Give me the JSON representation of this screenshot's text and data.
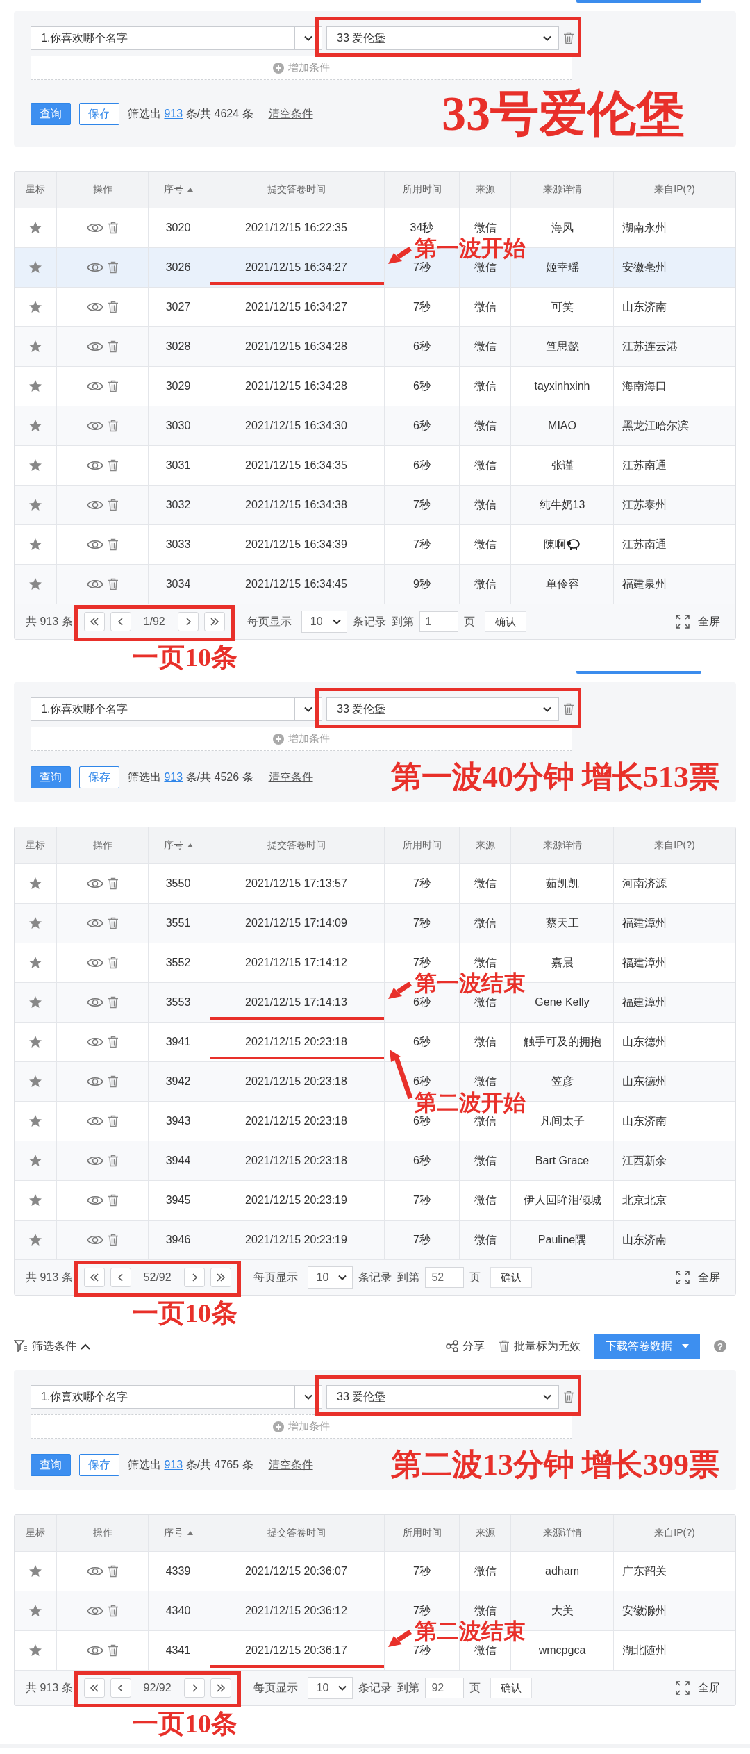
{
  "sections": [
    {
      "button_edge": true,
      "filter": {
        "field": "1.你喜欢哪个名字",
        "value": "33 爱伦堡",
        "value_frame": true,
        "add_label": "增加条件",
        "query": "查询",
        "save": "保存",
        "summary_prefix": "筛选出",
        "count": "913",
        "summary_suffix": "条/共 4624 条",
        "clear": "清空条件",
        "headline": "33号爱伦堡"
      },
      "columns": [
        "星标",
        "操作",
        "序号",
        "提交答卷时间",
        "所用时间",
        "来源",
        "来源详情",
        "来自IP(?)"
      ],
      "rows": [
        {
          "seq": "3020",
          "time": "2021/12/15 16:22:35",
          "duration": "34秒",
          "source": "微信",
          "detail": "海风",
          "detail_icon": false,
          "ip": "湖南永州",
          "selected": false
        },
        {
          "seq": "3026",
          "time": "2021/12/15 16:34:27",
          "duration": "7秒",
          "source": "微信",
          "detail": "姬幸瑶",
          "detail_icon": false,
          "ip": "安徽亳州",
          "selected": true,
          "annotation": {
            "label": "第一波开始",
            "kind": "from-above"
          }
        },
        {
          "seq": "3027",
          "time": "2021/12/15 16:34:27",
          "duration": "7秒",
          "source": "微信",
          "detail": "可笑",
          "detail_icon": false,
          "ip": "山东济南",
          "selected": false
        },
        {
          "seq": "3028",
          "time": "2021/12/15 16:34:28",
          "duration": "6秒",
          "source": "微信",
          "detail": "笪思懿",
          "detail_icon": false,
          "ip": "江苏连云港",
          "selected": false
        },
        {
          "seq": "3029",
          "time": "2021/12/15 16:34:28",
          "duration": "6秒",
          "source": "微信",
          "detail": "tayxinhxinh",
          "detail_icon": false,
          "ip": "海南海口",
          "selected": false
        },
        {
          "seq": "3030",
          "time": "2021/12/15 16:34:30",
          "duration": "6秒",
          "source": "微信",
          "detail": "MIAO",
          "detail_icon": false,
          "ip": "黑龙江哈尔滨",
          "selected": false
        },
        {
          "seq": "3031",
          "time": "2021/12/15 16:34:35",
          "duration": "6秒",
          "source": "微信",
          "detail": "张谨",
          "detail_icon": false,
          "ip": "江苏南通",
          "selected": false
        },
        {
          "seq": "3032",
          "time": "2021/12/15 16:34:38",
          "duration": "7秒",
          "source": "微信",
          "detail": "纯牛奶13",
          "detail_icon": false,
          "ip": "江苏泰州",
          "selected": false
        },
        {
          "seq": "3033",
          "time": "2021/12/15 16:34:39",
          "duration": "7秒",
          "source": "微信",
          "detail": "陳啊",
          "detail_icon": true,
          "ip": "江苏南通",
          "selected": false
        },
        {
          "seq": "3034",
          "time": "2021/12/15 16:34:45",
          "duration": "9秒",
          "source": "微信",
          "detail": "单伶容",
          "detail_icon": false,
          "ip": "福建泉州",
          "selected": false
        }
      ],
      "pagination": {
        "total": "共 913 条",
        "page": "1/92",
        "per_page_label": "每页显示",
        "per_page": "10",
        "records_label": "条记录",
        "goto_label": "到第",
        "goto_value": "1",
        "page_label": "页",
        "confirm": "确认",
        "fullscreen": "全屏",
        "pager_frame": true
      },
      "page_note": "一页10条"
    },
    {
      "button_edge": true,
      "filter": {
        "field": "1.你喜欢哪个名字",
        "value": "33 爱伦堡",
        "value_frame": true,
        "add_label": "增加条件",
        "query": "查询",
        "save": "保存",
        "summary_prefix": "筛选出",
        "count": "913",
        "summary_suffix": "条/共 4526 条",
        "clear": "清空条件",
        "headline": "第一波40分钟 增长513票"
      },
      "columns": [
        "星标",
        "操作",
        "序号",
        "提交答卷时间",
        "所用时间",
        "来源",
        "来源详情",
        "来自IP(?)"
      ],
      "rows": [
        {
          "seq": "3550",
          "time": "2021/12/15 17:13:57",
          "duration": "7秒",
          "source": "微信",
          "detail": "茹凯凯",
          "detail_icon": false,
          "ip": "河南济源",
          "selected": false
        },
        {
          "seq": "3551",
          "time": "2021/12/15 17:14:09",
          "duration": "7秒",
          "source": "微信",
          "detail": "蔡天工",
          "detail_icon": false,
          "ip": "福建漳州",
          "selected": false
        },
        {
          "seq": "3552",
          "time": "2021/12/15 17:14:12",
          "duration": "7秒",
          "source": "微信",
          "detail": "嘉晨",
          "detail_icon": false,
          "ip": "福建漳州",
          "selected": false
        },
        {
          "seq": "3553",
          "time": "2021/12/15 17:14:13",
          "duration": "6秒",
          "source": "微信",
          "detail": "Gene Kelly",
          "detail_icon": false,
          "ip": "福建漳州",
          "selected": false,
          "annotation": {
            "label": "第一波结束",
            "kind": "from-above"
          }
        },
        {
          "seq": "3941",
          "time": "2021/12/15 20:23:18",
          "duration": "6秒",
          "source": "微信",
          "detail": "触手可及的拥抱",
          "detail_icon": false,
          "ip": "山东德州",
          "selected": false,
          "annotation": {
            "label": "第二波开始",
            "kind": "from-below"
          }
        },
        {
          "seq": "3942",
          "time": "2021/12/15 20:23:18",
          "duration": "6秒",
          "source": "微信",
          "detail": "笠彦",
          "detail_icon": false,
          "ip": "山东德州",
          "selected": false
        },
        {
          "seq": "3943",
          "time": "2021/12/15 20:23:18",
          "duration": "6秒",
          "source": "微信",
          "detail": "凡间太子",
          "detail_icon": false,
          "ip": "山东济南",
          "selected": false
        },
        {
          "seq": "3944",
          "time": "2021/12/15 20:23:18",
          "duration": "6秒",
          "source": "微信",
          "detail": "Bart Grace",
          "detail_icon": false,
          "ip": "江西新余",
          "selected": false
        },
        {
          "seq": "3945",
          "time": "2021/12/15 20:23:19",
          "duration": "7秒",
          "source": "微信",
          "detail": "伊人回眸泪倾城",
          "detail_icon": false,
          "ip": "北京北京",
          "selected": false
        },
        {
          "seq": "3946",
          "time": "2021/12/15 20:23:19",
          "duration": "7秒",
          "source": "微信",
          "detail": "Pauline隅",
          "detail_icon": false,
          "ip": "山东济南",
          "selected": false
        }
      ],
      "pagination": {
        "total": "共 913 条",
        "page": "52/92",
        "per_page_label": "每页显示",
        "per_page": "10",
        "records_label": "条记录",
        "goto_label": "到第",
        "goto_value": "52",
        "page_label": "页",
        "confirm": "确认",
        "fullscreen": "全屏",
        "pager_frame": true
      },
      "page_note": "一页10条"
    },
    {
      "button_edge": false,
      "toolbar": {
        "filter_label": "筛选条件",
        "share": "分享",
        "invalidate": "批量标为无效",
        "download": "下载答卷数据",
        "help": "?"
      },
      "filter": {
        "field": "1.你喜欢哪个名字",
        "value": "33 爱伦堡",
        "value_frame": true,
        "add_label": "增加条件",
        "query": "查询",
        "save": "保存",
        "summary_prefix": "筛选出",
        "count": "913",
        "summary_suffix": "条/共 4765 条",
        "clear": "清空条件",
        "headline": "第二波13分钟 增长399票"
      },
      "columns": [
        "星标",
        "操作",
        "序号",
        "提交答卷时间",
        "所用时间",
        "来源",
        "来源详情",
        "来自IP(?)"
      ],
      "rows": [
        {
          "seq": "4339",
          "time": "2021/12/15 20:36:07",
          "duration": "7秒",
          "source": "微信",
          "detail": "adham",
          "detail_icon": false,
          "ip": "广东韶关",
          "selected": false
        },
        {
          "seq": "4340",
          "time": "2021/12/15 20:36:12",
          "duration": "7秒",
          "source": "微信",
          "detail": "大美",
          "detail_icon": false,
          "ip": "安徽滁州",
          "selected": false
        },
        {
          "seq": "4341",
          "time": "2021/12/15 20:36:17",
          "duration": "7秒",
          "source": "微信",
          "detail": "wmcpgca",
          "detail_icon": false,
          "ip": "湖北随州",
          "selected": false,
          "annotation": {
            "label": "第二波结束",
            "kind": "from-above"
          }
        }
      ],
      "pagination": {
        "total": "共 913 条",
        "page": "92/92",
        "per_page_label": "每页显示",
        "per_page": "10",
        "records_label": "条记录",
        "goto_label": "到第",
        "goto_value": "92",
        "page_label": "页",
        "confirm": "确认",
        "fullscreen": "全屏",
        "pager_frame": true
      },
      "page_note": "一页10条"
    }
  ]
}
